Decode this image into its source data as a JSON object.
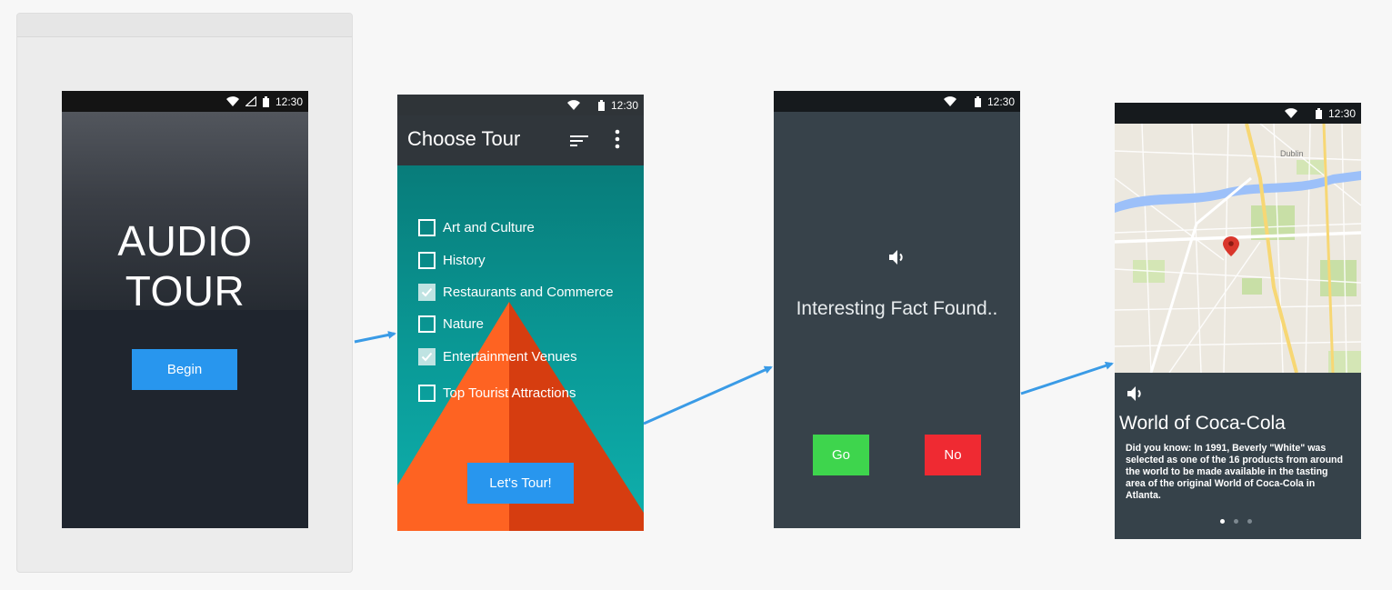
{
  "colors": {
    "page_bg": "#f7f7f7",
    "accent_blue": "#2896ee",
    "arrow_blue": "#3a9be6",
    "go_green": "#3ed54d",
    "no_red": "#ef2a32",
    "teal": "#0a9b98",
    "pyramid_orange": "#fe6322",
    "pyramid_dark_orange": "#d63d10"
  },
  "status_bar": {
    "time": "12:30"
  },
  "screen1": {
    "title_line1": "AUDIO",
    "title_line2": "TOUR",
    "begin_label": "Begin"
  },
  "screen2": {
    "appbar_title": "Choose Tour",
    "sort_icon": "sort-icon",
    "more_icon": "more-vert-icon",
    "options": [
      {
        "label": "Art and Culture",
        "checked": false
      },
      {
        "label": "History",
        "checked": false
      },
      {
        "label": "Restaurants and Commerce",
        "checked": true
      },
      {
        "label": "Nature",
        "checked": false
      },
      {
        "label": "Entertainment Venues",
        "checked": true
      },
      {
        "label": "Top Tourist Attractions",
        "checked": false
      }
    ],
    "tour_label": "Let's Tour!"
  },
  "screen3": {
    "speaker_icon": "volume-icon",
    "fact_text": "Interesting Fact Found..",
    "go_label": "Go",
    "no_label": "No"
  },
  "screen4": {
    "map_label": "Dublin",
    "speaker_icon": "volume-icon",
    "place_title": "World of Coca-Cola",
    "description": "Did you know: In 1991, Beverly \"White\" was selected as one of the 16 products from around the world to be made available in the tasting area of the original World of Coca-Cola in Atlanta.",
    "pager": {
      "pages": 3,
      "active": 1
    }
  }
}
